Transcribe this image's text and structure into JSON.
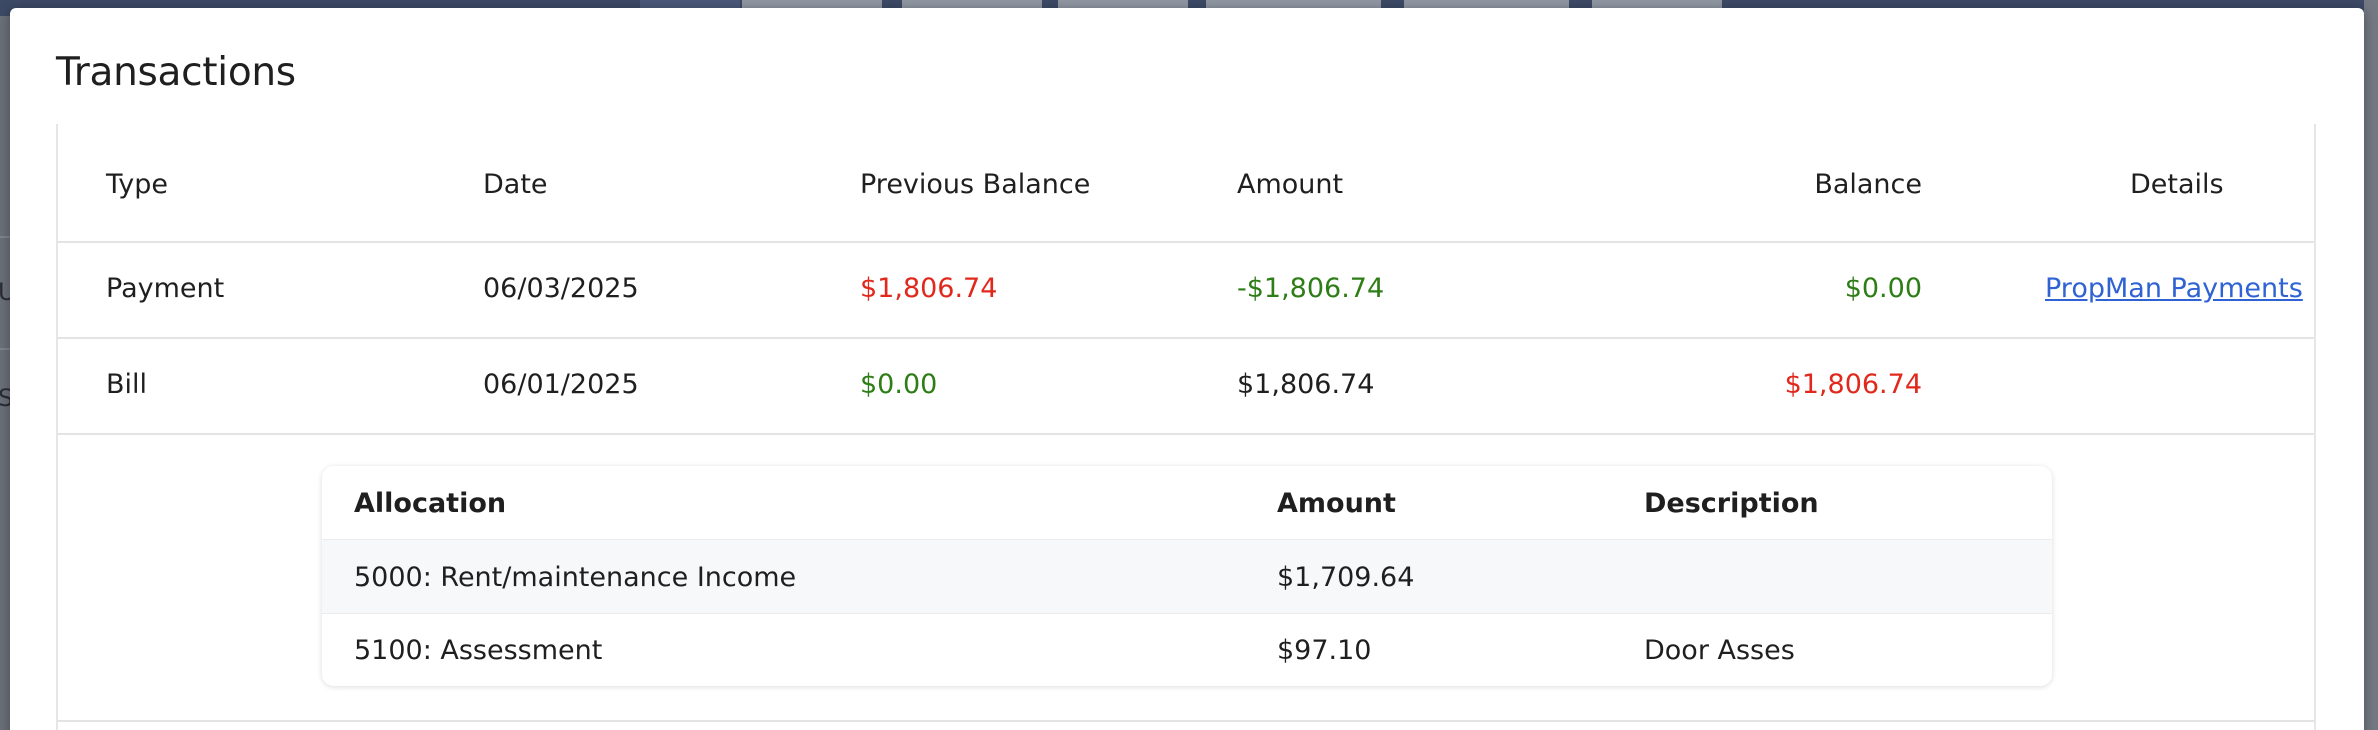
{
  "modal": {
    "title": "Transactions"
  },
  "table": {
    "columns": [
      "Type",
      "Date",
      "Previous Balance",
      "Amount",
      "Balance",
      "Details"
    ],
    "rows": [
      {
        "type": "Payment",
        "date": "06/03/2025",
        "previous_balance": "$1,806.74",
        "amount": "-$1,806.74",
        "balance": "$0.00",
        "details": "PropMan Payments"
      },
      {
        "type": "Bill",
        "date": "06/01/2025",
        "previous_balance": "$0.00",
        "amount": "$1,806.74",
        "balance": "$1,806.74",
        "details": ""
      }
    ]
  },
  "allocations": {
    "columns": [
      "Allocation",
      "Amount",
      "Description"
    ],
    "rows": [
      {
        "allocation": "5000: Rent/maintenance Income",
        "amount": "$1,709.64",
        "description": ""
      },
      {
        "allocation": "5100: Assessment",
        "amount": "$97.10",
        "description": "Door Asses"
      }
    ]
  },
  "background": {
    "glyphs": [
      "U",
      "S"
    ]
  },
  "colors": {
    "negative_balance": "#e0281c",
    "positive_balance": "#2e7d17",
    "link": "#2f63d4",
    "backdrop": "#6b7079"
  }
}
